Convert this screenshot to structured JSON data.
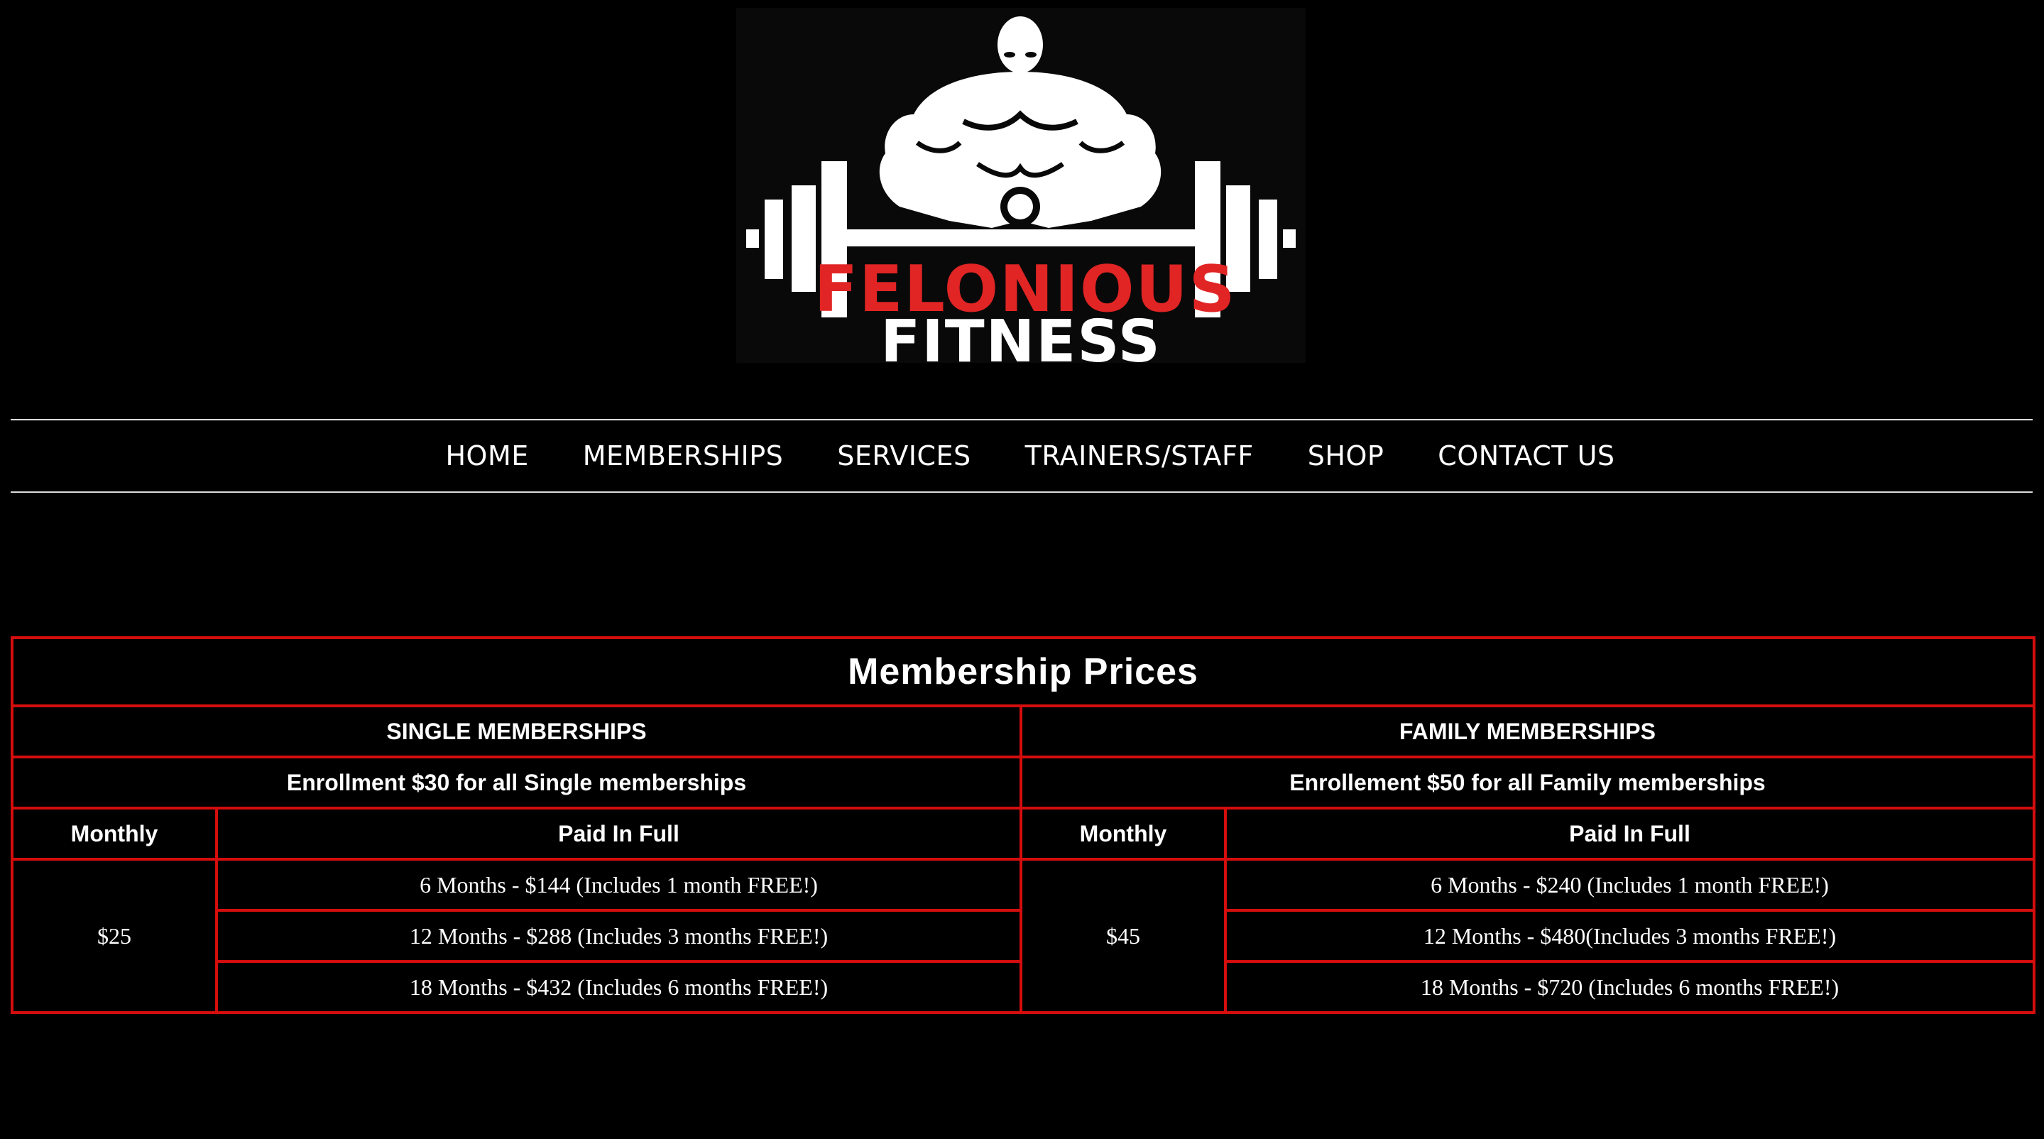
{
  "logo": {
    "line1": "FELONIOUS",
    "line2": "FITNESS",
    "colors": {
      "red": "#e12424",
      "white": "#ffffff",
      "background": "#090909"
    },
    "icon": "bodybuilder-barbell-logo"
  },
  "nav": {
    "items": [
      {
        "label": "HOME"
      },
      {
        "label": "MEMBERSHIPS"
      },
      {
        "label": "SERVICES"
      },
      {
        "label": "TRAINERS/STAFF"
      },
      {
        "label": "SHOP"
      },
      {
        "label": "CONTACT US"
      }
    ]
  },
  "table": {
    "title": "Membership Prices",
    "border_color": "#d40d0d",
    "single": {
      "heading": "SINGLE MEMBERSHIPS",
      "enrollment": "Enrollment $30 for all Single memberships",
      "monthly_header": "Monthly",
      "paid_header": "Paid In Full",
      "monthly_price": "$25",
      "plans": [
        "6 Months - $144 (Includes 1 month FREE!)",
        "12 Months - $288 (Includes 3 months FREE!)",
        "18 Months - $432 (Includes 6 months FREE!)"
      ]
    },
    "family": {
      "heading": "FAMILY MEMBERSHIPS",
      "enrollment": "Enrollement $50 for all Family memberships",
      "monthly_header": "Monthly",
      "paid_header": "Paid In Full",
      "monthly_price": "$45",
      "plans": [
        "6 Months - $240 (Includes 1 month FREE!)",
        "12 Months - $480(Includes 3 months FREE!)",
        "18 Months - $720 (Includes 6 months FREE!)"
      ]
    }
  }
}
